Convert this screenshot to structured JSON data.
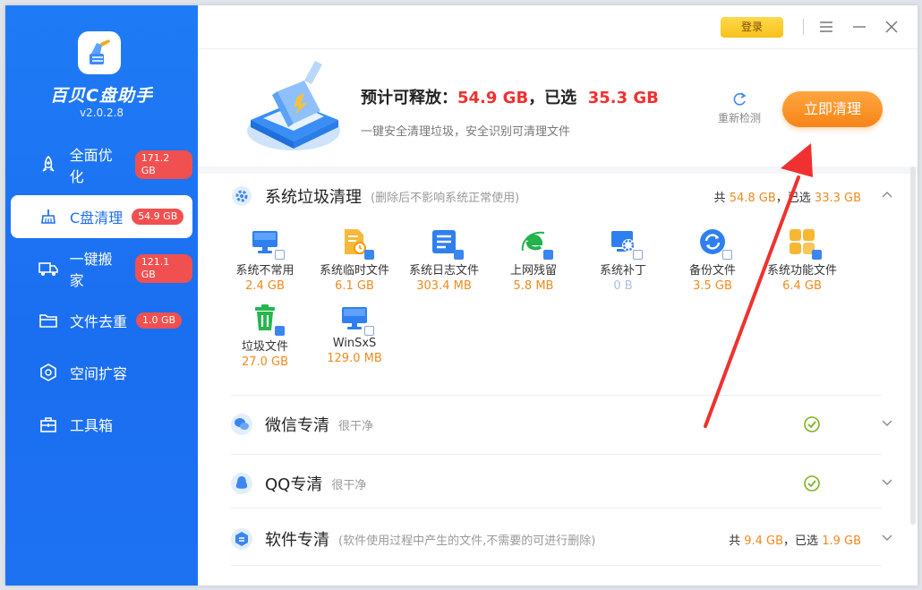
{
  "app": {
    "name": "百贝C盘助手",
    "version": "v2.0.2.8",
    "logo_icon": "broom-icon"
  },
  "nav": [
    {
      "label": "全面优化",
      "badge": "171.2 GB",
      "icon": "rocket-icon",
      "active": false
    },
    {
      "label": "C盘清理",
      "badge": "54.9 GB",
      "icon": "broom-icon",
      "active": true
    },
    {
      "label": "一键搬家",
      "badge": "121.1 GB",
      "icon": "truck-icon",
      "active": false
    },
    {
      "label": "文件去重",
      "badge": "1.0 GB",
      "icon": "folder-icon",
      "active": false
    },
    {
      "label": "空间扩容",
      "badge": "",
      "icon": "cube-icon",
      "active": false
    },
    {
      "label": "工具箱",
      "badge": "",
      "icon": "toolbox-icon",
      "active": false
    }
  ],
  "topbar": {
    "login_label": "登录",
    "menu_icon": "menu-icon",
    "minimize_icon": "minimize-icon",
    "close_icon": "close-icon"
  },
  "header": {
    "prefix": "预计可释放：",
    "releasable": "54.9 GB",
    "selected_prefix": "，已选",
    "selected": "35.3 GB",
    "subtitle": "一键安全清理垃圾，安全识别可清理文件",
    "rescan_label": "重新检测",
    "clean_label": "立即清理"
  },
  "sections": {
    "system": {
      "title": "系统垃圾清理",
      "note": "(删除后不影响系统正常使用)",
      "total_prefix": "共",
      "total": "54.8 GB",
      "selected_prefix": "，已选",
      "selected": "33.3 GB",
      "items": [
        {
          "name": "系统不常用",
          "size": "2.4 GB",
          "checked": false,
          "icon": "monitor-icon"
        },
        {
          "name": "系统临时文件",
          "size": "6.1 GB",
          "checked": true,
          "icon": "temp-file-icon"
        },
        {
          "name": "系统日志文件",
          "size": "303.4 MB",
          "checked": true,
          "icon": "log-file-icon"
        },
        {
          "name": "上网残留",
          "size": "5.8 MB",
          "checked": true,
          "icon": "browser-icon"
        },
        {
          "name": "系统补丁",
          "size": "0 B",
          "checked": false,
          "icon": "patch-icon"
        },
        {
          "name": "备份文件",
          "size": "3.5 GB",
          "checked": false,
          "icon": "backup-icon"
        },
        {
          "name": "系统功能文件",
          "size": "6.4 GB",
          "checked": true,
          "icon": "feature-icon"
        },
        {
          "name": "垃圾文件",
          "size": "27.0 GB",
          "checked": true,
          "icon": "trash-icon"
        },
        {
          "name": "WinSxS",
          "size": "129.0 MB",
          "checked": false,
          "icon": "winsxs-icon"
        }
      ]
    },
    "wechat": {
      "title": "微信专清",
      "note": "很干净",
      "icon": "wechat-icon"
    },
    "qq": {
      "title": "QQ专清",
      "note": "很干净",
      "icon": "qq-icon"
    },
    "software": {
      "title": "软件专清",
      "note": "(软件使用过程中产生的文件,不需要的可进行删除)",
      "total_prefix": "共",
      "total": "9.4 GB",
      "selected_prefix": "，已选",
      "selected": "1.9 GB",
      "icon": "software-icon"
    }
  },
  "colors": {
    "sidebar": "#1f7bf5",
    "accent_orange": "#f78416",
    "badge_red": "#f0504f",
    "highlight_red": "#f0312f",
    "size_orange": "#f08a1c"
  }
}
